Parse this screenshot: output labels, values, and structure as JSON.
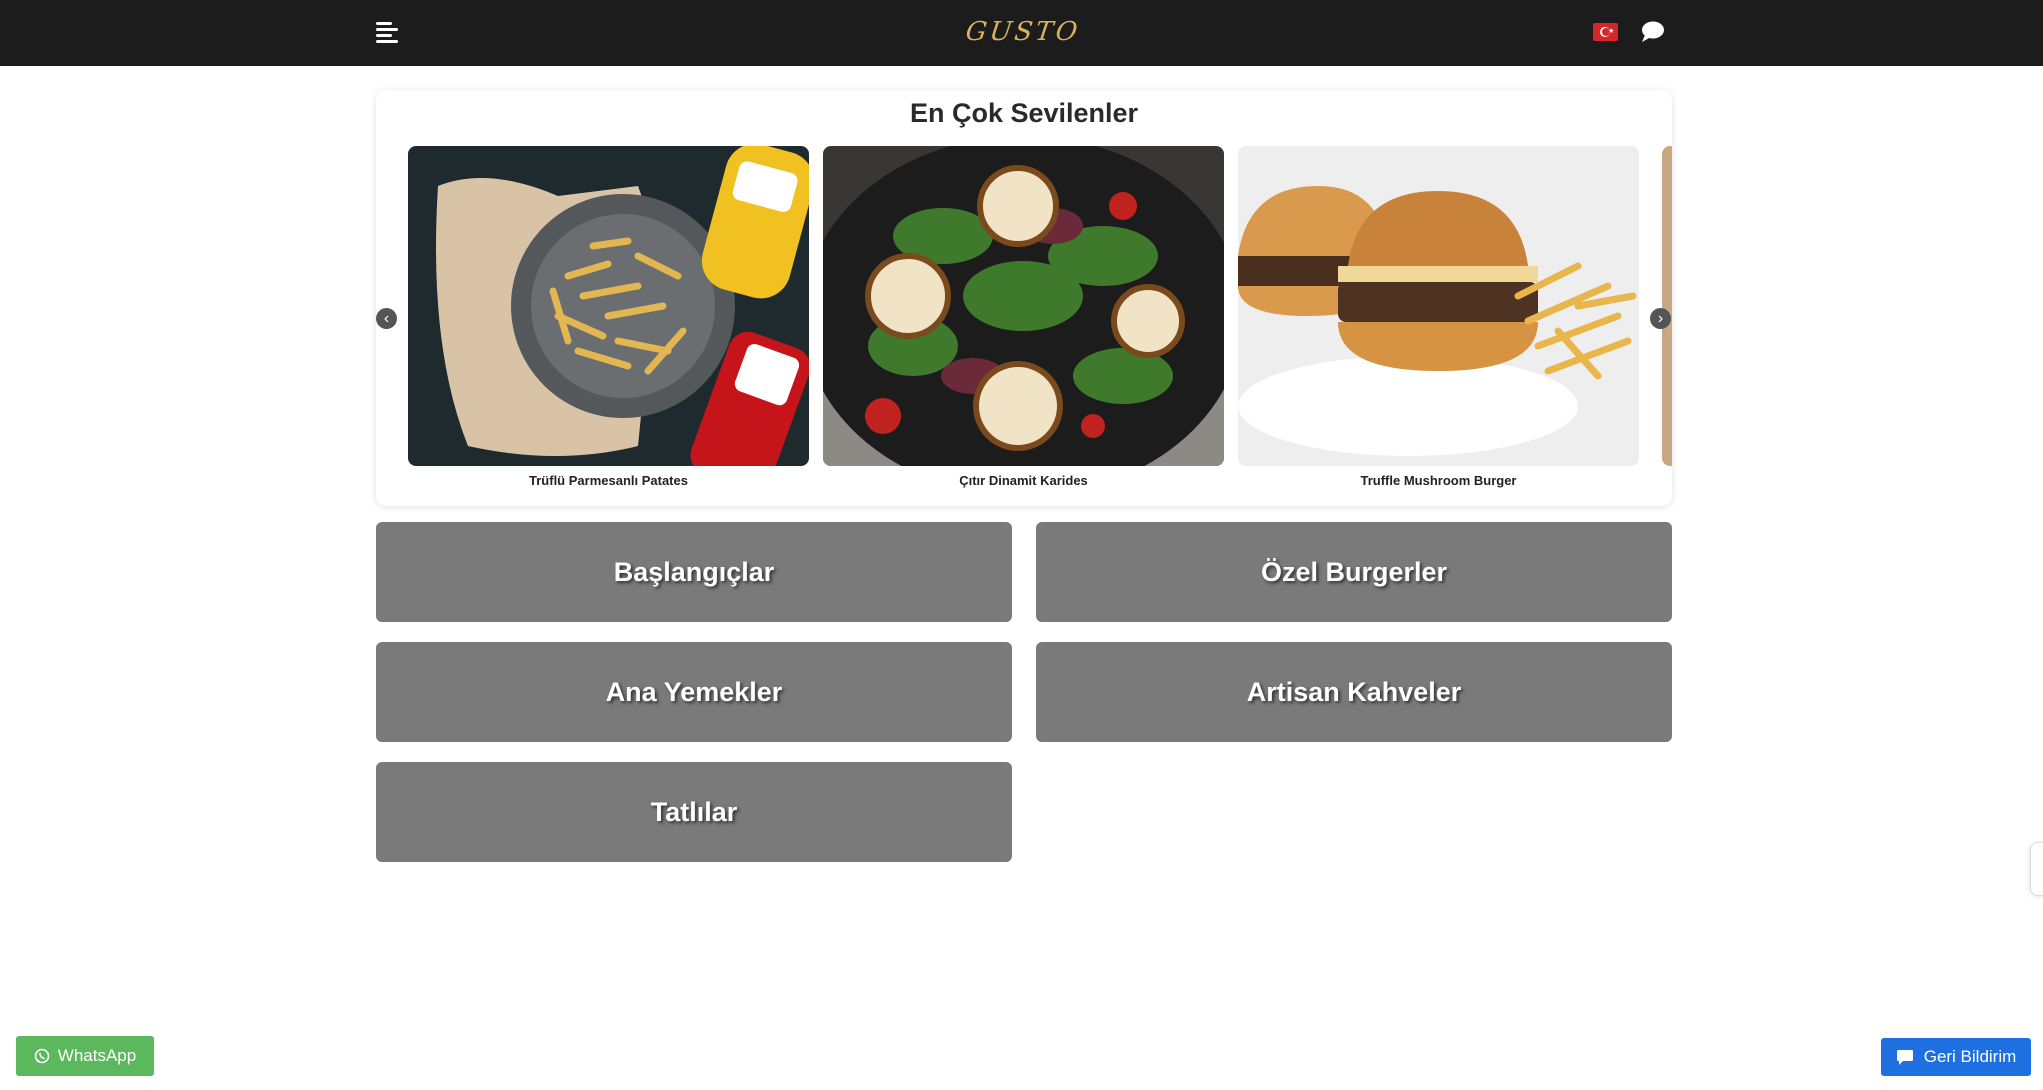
{
  "header": {
    "logo_text": "GUSTO",
    "menu_icon": "hamburger-menu-icon",
    "flag_icon": "turkey-flag-icon",
    "chat_icon": "chat-bubble-icon"
  },
  "favorites": {
    "title": "En Çok Sevilenler",
    "items": [
      {
        "caption": "Trüflü Parmesanlı Patates",
        "image": "truffle-parmesan-fries-photo"
      },
      {
        "caption": "Çıtır Dinamit Karides",
        "image": "crispy-dynamite-shrimp-salad-photo"
      },
      {
        "caption": "Truffle Mushroom Burger",
        "image": "truffle-mushroom-burger-photo"
      }
    ],
    "prev_icon": "chevron-left-icon",
    "next_icon": "chevron-right-icon"
  },
  "categories": [
    {
      "label": "Başlangıçlar"
    },
    {
      "label": "Özel Burgerler"
    },
    {
      "label": "Ana Yemekler"
    },
    {
      "label": "Artisan Kahveler"
    },
    {
      "label": "Tatlılar"
    }
  ],
  "buttons": {
    "whatsapp_label": "WhatsApp",
    "feedback_label": "Geri Bildirim"
  },
  "colors": {
    "header_bg": "#1c1c1c",
    "logo": "#d8b35a",
    "category_bg": "#7a7a7a",
    "whatsapp": "#5cb85c",
    "feedback": "#1e6fe0"
  }
}
